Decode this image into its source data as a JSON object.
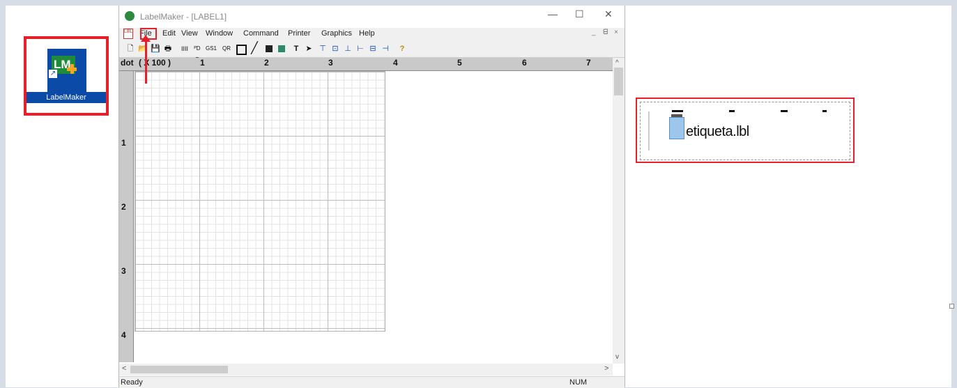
{
  "desktop": {
    "shortcut_label": "LabelMaker",
    "icon_text": "LM"
  },
  "window": {
    "title": "LabelMaker - [LABEL1]",
    "controls": {
      "minimize": "—",
      "maximize": "☐",
      "close": "✕"
    }
  },
  "menu": {
    "doc_icon_text": "LBL",
    "items": [
      "File",
      "Edit",
      "View",
      "Window",
      "Command",
      "Printer",
      "Graphics",
      "Help"
    ],
    "child_controls": [
      "_",
      "ᗺ",
      "×"
    ]
  },
  "toolbar": {
    "icons": [
      "new-icon",
      "open-icon",
      "save-icon",
      "print-icon",
      "barcode-icon",
      "pdf417-icon",
      "gs1-icon",
      "qr-icon",
      "rectangle-icon",
      "line-icon",
      "image-icon",
      "picture-icon",
      "text-icon",
      "pointer-icon",
      "align-top-icon",
      "align-center-icon",
      "align-bottom-icon",
      "align-left-icon",
      "align-middle-icon",
      "align-right-icon",
      "help-icon"
    ],
    "labels": {
      "barcode": "IIII",
      "pdf": "ᴾD F",
      "gs1": "GS1",
      "qr": "QR",
      "text": "T",
      "help": "?"
    }
  },
  "ruler": {
    "unit": "dot",
    "scale": "( X 100 )",
    "top_numbers": [
      "1",
      "2",
      "3",
      "4",
      "5",
      "6",
      "7"
    ],
    "left_numbers": [
      "1",
      "2",
      "3",
      "4"
    ]
  },
  "scroll": {
    "up": "^",
    "down": "v",
    "left": "<",
    "right": ">"
  },
  "status": {
    "left": "Ready",
    "right": "NUM"
  },
  "file": {
    "name": "etiqueta.lbl",
    "icon": "text-document-icon"
  },
  "colors": {
    "highlight": "#e5202a",
    "icon_blue": "#0c4aa8",
    "icon_green": "#1e8a3a"
  }
}
